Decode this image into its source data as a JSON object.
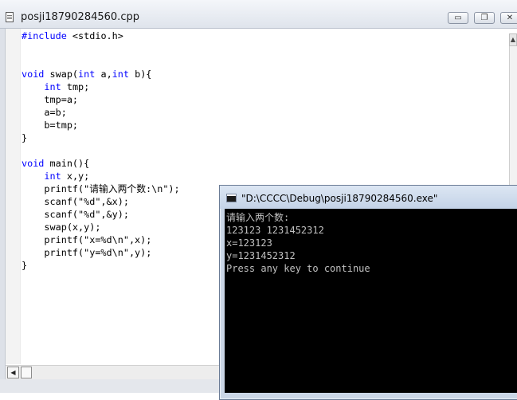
{
  "editor": {
    "title": "posji18790284560.cpp",
    "buttons": {
      "minimize": "▭",
      "restore": "❐",
      "close": "✕"
    },
    "code_lines": [
      [
        {
          "t": "#include",
          "k": true
        },
        {
          "t": " <stdio.h>"
        }
      ],
      [],
      [],
      [
        {
          "t": "void",
          "k": true
        },
        {
          "t": " swap("
        },
        {
          "t": "int",
          "k": true
        },
        {
          "t": " a,"
        },
        {
          "t": "int",
          "k": true
        },
        {
          "t": " b){"
        }
      ],
      [
        {
          "t": "    "
        },
        {
          "t": "int",
          "k": true
        },
        {
          "t": " tmp;"
        }
      ],
      [
        {
          "t": "    tmp=a;"
        }
      ],
      [
        {
          "t": "    a=b;"
        }
      ],
      [
        {
          "t": "    b=tmp;"
        }
      ],
      [
        {
          "t": "}"
        }
      ],
      [],
      [
        {
          "t": "void",
          "k": true
        },
        {
          "t": " main(){"
        }
      ],
      [
        {
          "t": "    "
        },
        {
          "t": "int",
          "k": true
        },
        {
          "t": " x,y;"
        }
      ],
      [
        {
          "t": "    printf(\"请输入两个数:\\n\");"
        }
      ],
      [
        {
          "t": "    scanf(\"%d\",&x);"
        }
      ],
      [
        {
          "t": "    scanf(\"%d\",&y);"
        }
      ],
      [
        {
          "t": "    swap(x,y);"
        }
      ],
      [
        {
          "t": "    printf(\"x=%d\\n\",x);"
        }
      ],
      [
        {
          "t": "    printf(\"y=%d\\n\",y);"
        }
      ],
      [
        {
          "t": "}"
        }
      ]
    ],
    "keyword_color": "#0000ff",
    "scroll_up_arrow": "▲",
    "scroll_left_arrow": "◀"
  },
  "console": {
    "title": "\"D:\\CCCC\\Debug\\posji18790284560.exe\"",
    "output_lines": [
      "请输入两个数:",
      "123123 1231452312",
      "x=123123",
      "y=1231452312",
      "Press any key to continue"
    ],
    "background": "#000000",
    "text_color": "#c0c0c0"
  }
}
